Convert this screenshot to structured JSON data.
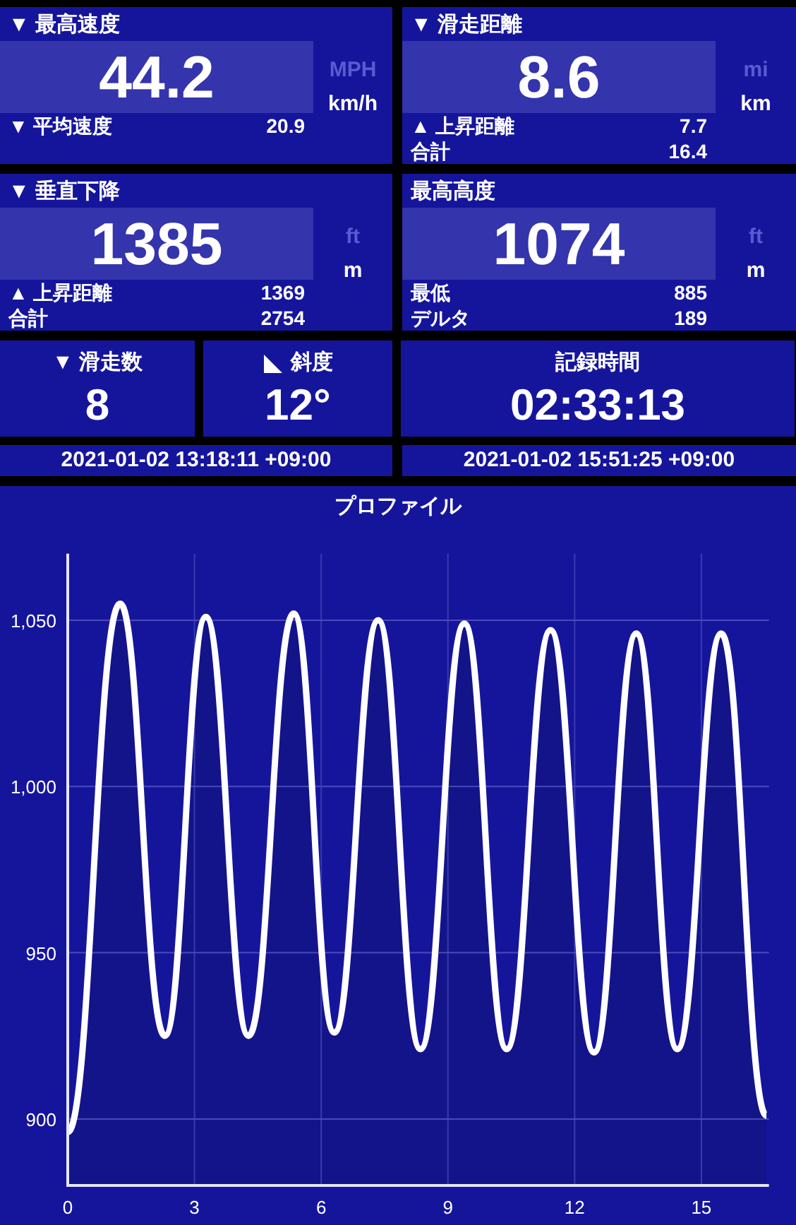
{
  "panels": [
    {
      "title": "▼ 最高速度",
      "value": "44.2",
      "units": [
        {
          "label": "MPH",
          "selected": false
        },
        {
          "label": "km/h",
          "selected": true
        }
      ],
      "rows": [
        {
          "label": "▼ 平均速度",
          "value": "20.9"
        }
      ]
    },
    {
      "title": "▼ 滑走距離",
      "value": "8.6",
      "units": [
        {
          "label": "mi",
          "selected": false
        },
        {
          "label": "km",
          "selected": true
        }
      ],
      "rows": [
        {
          "label": "▲ 上昇距離",
          "value": "7.7"
        },
        {
          "label": "合計",
          "value": "16.4"
        }
      ]
    },
    {
      "title": "▼ 垂直下降",
      "value": "1385",
      "units": [
        {
          "label": "ft",
          "selected": false
        },
        {
          "label": "m",
          "selected": true
        }
      ],
      "rows": [
        {
          "label": "▲ 上昇距離",
          "value": "1369"
        },
        {
          "label": "合計",
          "value": "2754"
        }
      ]
    },
    {
      "title": "最高高度",
      "value": "1074",
      "units": [
        {
          "label": "ft",
          "selected": false
        },
        {
          "label": "m",
          "selected": true
        }
      ],
      "rows": [
        {
          "label": "最低",
          "value": "885"
        },
        {
          "label": "デルタ",
          "value": "189"
        }
      ]
    }
  ],
  "stats": [
    {
      "kind": "plain",
      "title": "▼ 滑走数",
      "value": "8"
    },
    {
      "kind": "slope",
      "title": "斜度",
      "value": "12°"
    },
    {
      "kind": "plain",
      "title": "記録時間",
      "value": "02:33:13"
    }
  ],
  "times": [
    "2021-01-02 13:18:11 +09:00",
    "2021-01-02 15:51:25 +09:00"
  ],
  "profile": {
    "title": "プロファイル",
    "chart_data": {
      "type": "area",
      "grid": true,
      "xlim": [
        0,
        16.6
      ],
      "ylim": [
        880,
        1070
      ],
      "xticks": [
        0,
        3,
        6,
        9,
        12,
        15
      ],
      "yticks": [
        {
          "value": 900,
          "label": "900"
        },
        {
          "value": 950,
          "label": "950"
        },
        {
          "value": 1000,
          "label": "1,000"
        },
        {
          "value": 1050,
          "label": "1,050"
        }
      ],
      "x": [
        0,
        1.24,
        2.3,
        3.27,
        4.28,
        5.35,
        6.31,
        7.35,
        8.35,
        9.39,
        10.39,
        11.43,
        12.46,
        13.46,
        14.43,
        15.47,
        16.54
      ],
      "series": [
        {
          "color": "#ffffff",
          "values": [
            896,
            1055,
            925,
            1051,
            925,
            1052,
            926,
            1050,
            921,
            1049,
            921,
            1047,
            920,
            1046,
            921,
            1046,
            901
          ]
        }
      ]
    }
  }
}
